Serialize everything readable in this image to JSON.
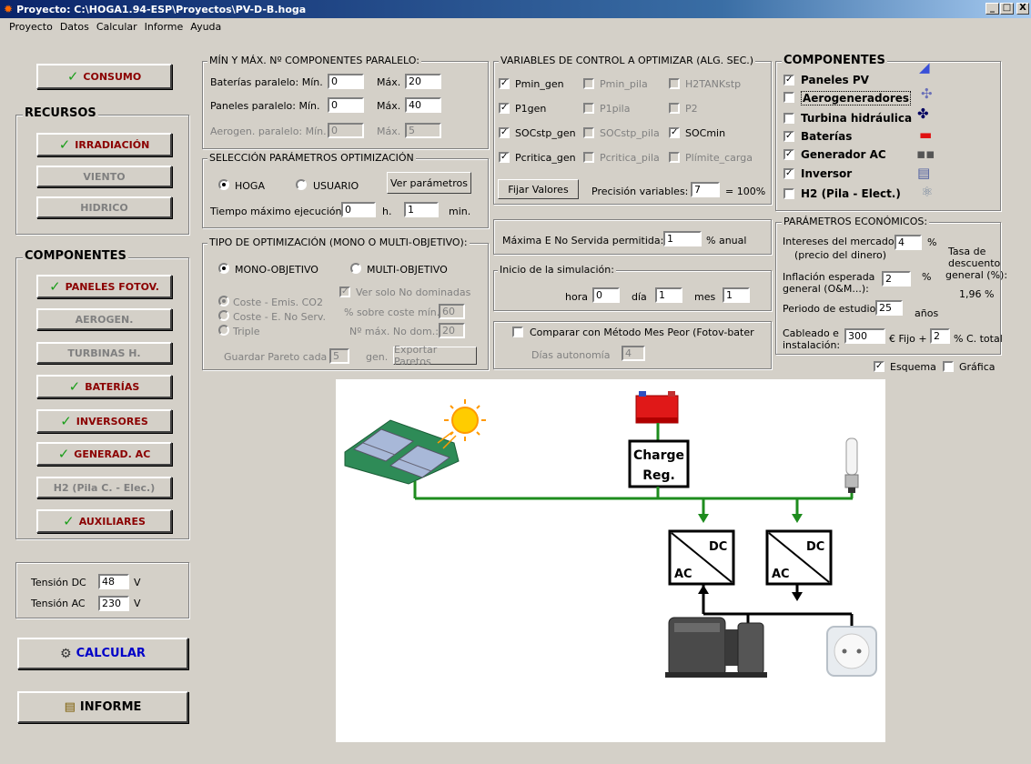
{
  "window": {
    "title": "Proyecto: C:\\HOGA1.94-ESP\\Proyectos\\PV-D-B.hoga",
    "min": "_",
    "max": "□",
    "close": "X"
  },
  "menu": [
    "Proyecto",
    "Datos",
    "Calcular",
    "Informe",
    "Ayuda"
  ],
  "left": {
    "consumo": "CONSUMO",
    "recursos_title": "RECURSOS",
    "irradiacion": "IRRADIACIÓN",
    "viento": "VIENTO",
    "hidrico": "HIDRICO",
    "componentes_title": "COMPONENTES",
    "paneles": "PANELES FOTOV.",
    "aerogen": "AEROGEN.",
    "turbinas": "TURBINAS H.",
    "baterias": "BATERÍAS",
    "inversores": "INVERSORES",
    "generad": "GENERAD. AC",
    "h2": "H2 (Pila C. - Elec.)",
    "auxiliares": "AUXILIARES",
    "tension_dc_label": "Tensión DC",
    "tension_dc": "48",
    "tension_ac_label": "Tensión AC",
    "tension_ac": "230",
    "unit_v": "V",
    "calcular": "CALCULAR",
    "informe": "INFORME",
    "check": "✓"
  },
  "paralelo": {
    "title": "MÍN Y MÁX. Nº COMPONENTES PARALELO:",
    "bat_label": "Baterías paralelo: Mín.",
    "bat_min": "0",
    "max_label": "Máx.",
    "bat_max": "20",
    "pan_label": "Paneles paralelo:  Mín.",
    "pan_min": "0",
    "pan_max": "40",
    "aero_label": "Aerogen. paralelo: Mín.",
    "aero_min": "0",
    "aero_max": "5"
  },
  "seleccion": {
    "title": "SELECCIÓN PARÁMETROS OPTIMIZACIÓN",
    "hoga": "HOGA",
    "usuario": "USUARIO",
    "ver": "Ver parámetros",
    "tiempo_label": "Tiempo máximo ejecución:",
    "tiempo_h": "0",
    "h": "h.",
    "tiempo_min": "1",
    "min": "min."
  },
  "tipo": {
    "title": "TIPO DE OPTIMIZACIÓN (MONO O MULTI-OBJETIVO):",
    "mono": "MONO-OBJETIVO",
    "multi": "MULTI-OBJETIVO",
    "coste_emis": "Coste - Emis. CO2",
    "coste_enoserv": "Coste - E. No Serv.",
    "triple": "Triple",
    "ver_solo": "Ver solo No dominadas",
    "sobre_coste": "% sobre coste mín.",
    "sobre_coste_val": "60",
    "nmax": "Nº máx. No dom.:",
    "nmax_val": "20",
    "guardar": "Guardar Pareto cada",
    "guardar_val": "5",
    "gen": "gen.",
    "exportar": "Exportar Paretos"
  },
  "variables": {
    "title": "VARIABLES DE CONTROL A OPTIMIZAR (ALG. SEC.)",
    "pmin_gen": "Pmin_gen",
    "pmin_pila": "Pmin_pila",
    "h2tank": "H2TANKstp",
    "p1gen": "P1gen",
    "p1pila": "P1pila",
    "p2": "P2",
    "socstp_gen": "SOCstp_gen",
    "socstp_pila": "SOCstp_pila",
    "socmin": "SOCmin",
    "pcritica_gen": "Pcritica_gen",
    "pcritica_pila": "Pcritica_pila",
    "plimite": "Plímite_carga",
    "fijar": "Fijar Valores",
    "precision": "Precisión variables:",
    "precision_val": "7",
    "pct": "= 100%",
    "checkmark": "✓"
  },
  "maxima": {
    "label": "Máxima E No Servida permitida:",
    "val": "1",
    "unit": "% anual"
  },
  "inicio": {
    "title": "Inicio de la simulación:",
    "hora": "hora",
    "hora_val": "0",
    "dia": "día",
    "dia_val": "1",
    "mes": "mes",
    "mes_val": "1"
  },
  "comparar": {
    "label": "Comparar con Método Mes Peor (Fotov-bater",
    "dias": "Días autonomía",
    "dias_val": "4"
  },
  "componentes": {
    "title": "COMPONENTES",
    "items": [
      "Paneles PV",
      "Aerogeneradores",
      "Turbina hidráulica",
      "Baterías",
      "Generador AC",
      "Inversor",
      "H2 (Pila - Elect.)"
    ]
  },
  "economicos": {
    "title": "PARÁMETROS ECONÓMICOS:",
    "intereses": "Intereses del mercado:",
    "intereses2": "(precio del dinero)",
    "intereses_val": "4",
    "pct": "%",
    "tasa1": "Tasa de",
    "tasa2": "descuento",
    "tasa3": "general (%):",
    "tasa_val": "1,96 %",
    "inflacion": "Inflación esperada",
    "inflacion2": "general (O&M...):",
    "inflacion_val": "2",
    "periodo": "Periodo de estudio",
    "periodo_val": "25",
    "anos": "años",
    "cableado": "Cableado e",
    "cableado2": "instalación:",
    "cableado_val": "300",
    "fijo": "€ Fijo +",
    "ctotal_val": "2",
    "ctotal": "% C. total"
  },
  "esquema": "Esquema",
  "grafica": "Gráfica",
  "diagram": {
    "charge": "Charge",
    "reg": "Reg.",
    "dc": "DC",
    "ac": "AC"
  },
  "colors": {
    "title_start": "#0a246a",
    "check": "#1a9e1a",
    "red_label": "#8b0000",
    "bus": "#1e8c1e"
  }
}
